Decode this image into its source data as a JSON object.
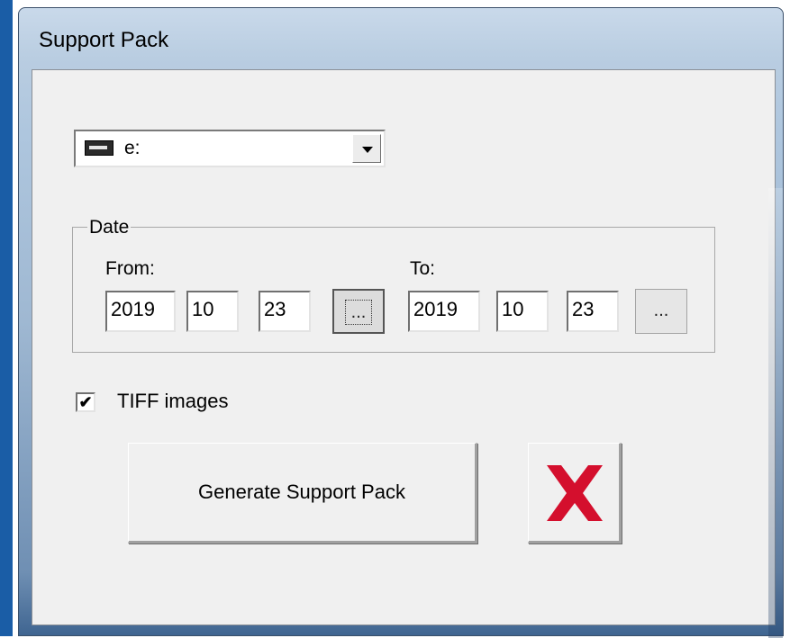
{
  "window": {
    "title": "Support Pack"
  },
  "drive": {
    "selected": "e:",
    "icon": "drive-icon"
  },
  "date": {
    "group_label": "Date",
    "from": {
      "label": "From:",
      "year": "2019",
      "month": "10",
      "day": "23",
      "picker_label": "..."
    },
    "to": {
      "label": "To:",
      "year": "2019",
      "month": "10",
      "day": "23",
      "picker_label": "..."
    }
  },
  "options": {
    "tiff_label": "TIFF images",
    "tiff_checked": true,
    "check_mark": "✔"
  },
  "actions": {
    "generate_label": "Generate Support Pack",
    "cancel_icon": "close-icon",
    "cancel_color": "#d40f2d"
  }
}
